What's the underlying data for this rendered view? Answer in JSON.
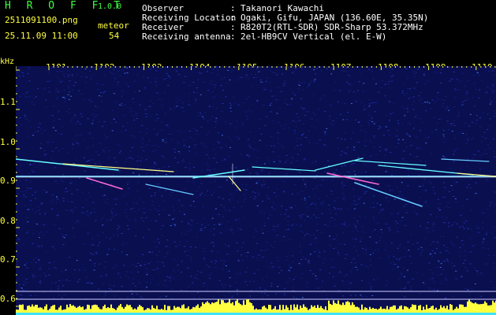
{
  "app": {
    "title": "H R O F F T",
    "version": "1.0.0",
    "filename": "2511091100.png",
    "datetime": "25.11.09 11:00",
    "meteor_label": "meteor",
    "meteor_count": "54"
  },
  "info": [
    {
      "label": "Observer",
      "value": "Takanori Kawachi"
    },
    {
      "label": "Receiving Location",
      "value": "Ogaki, Gifu, JAPAN (136.60E, 35.35N)"
    },
    {
      "label": "Receiver",
      "value": "R820T2(RTL-SDR) SDR-Sharp 53.372MHz"
    },
    {
      "label": "Receiving antenna",
      "value": "2el-HB9CV Vertical (el. E-W)"
    }
  ],
  "axis": {
    "y_unit": "kHz",
    "x_ticks": [
      "1101",
      "1102",
      "1103",
      "1104",
      "1105",
      "1106",
      "1107",
      "1108",
      "1109",
      "1110"
    ],
    "y_ticks": [
      "1.1",
      "1.0",
      "0.9",
      "0.8",
      "0.7",
      "0.6"
    ]
  },
  "colors": {
    "label_yellow": "#ffff40",
    "title_green": "#40ff40",
    "background": "#000000",
    "noise_blue": "#1a2a9a"
  }
}
